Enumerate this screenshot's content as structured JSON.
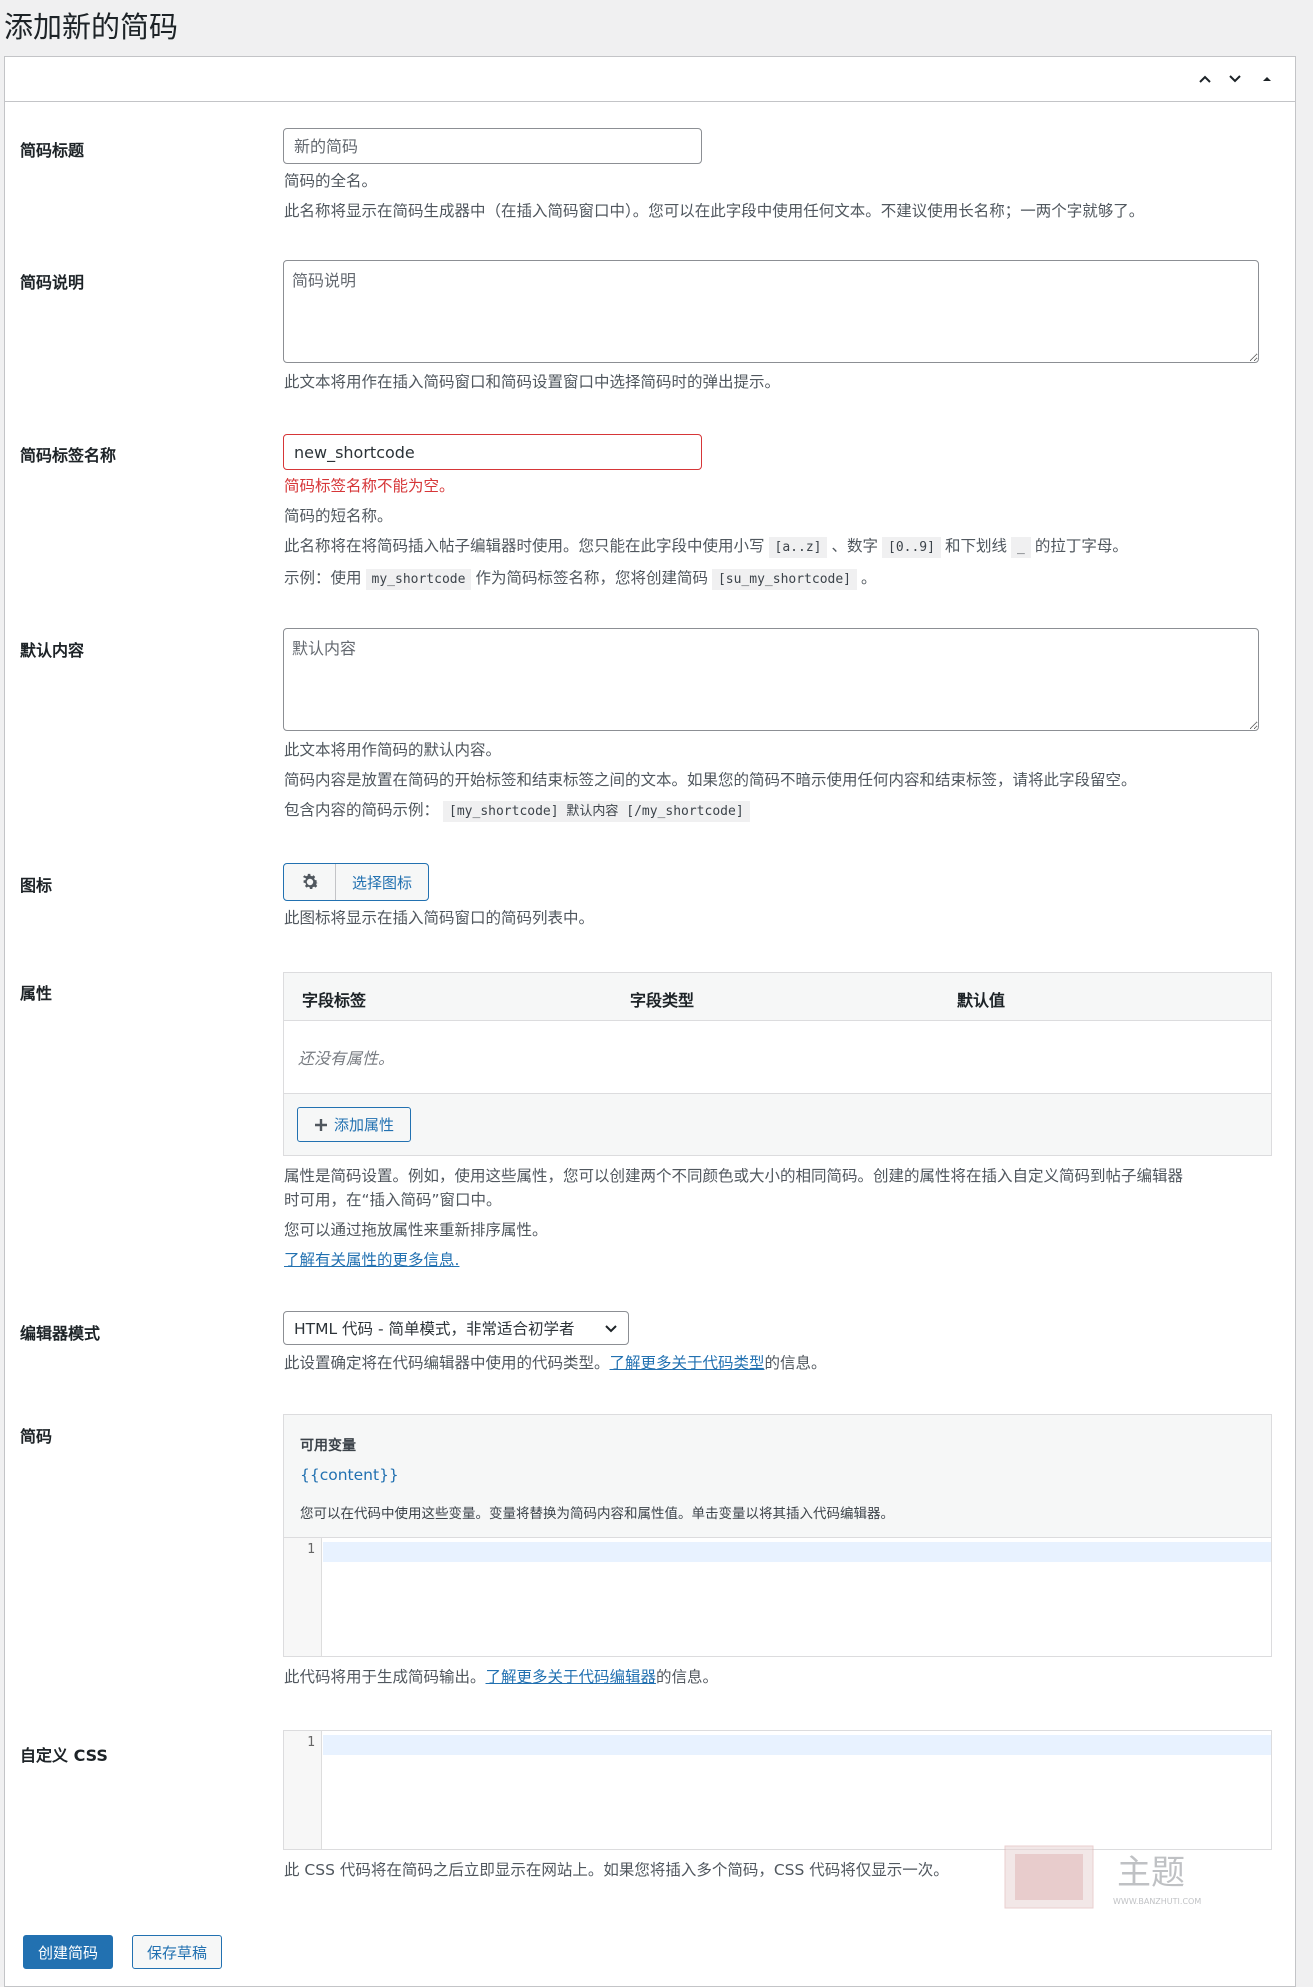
{
  "page": {
    "title": "添加新的简码"
  },
  "fields": {
    "title": {
      "label": "简码标题",
      "placeholder": "新的简码",
      "desc1": "简码的全名。",
      "desc2": "此名称将显示在简码生成器中（在插入简码窗口中）。您可以在此字段中使用任何文本。不建议使用长名称；一两个字就够了。"
    },
    "description": {
      "label": "简码说明",
      "placeholder": "简码说明",
      "desc": "此文本将用作在插入简码窗口和简码设置窗口中选择简码时的弹出提示。"
    },
    "tag": {
      "label": "简码标签名称",
      "value": "new_shortcode",
      "error": "简码标签名称不能为空。",
      "desc1": "简码的短名称。",
      "desc2_a": "此名称将在将简码插入帖子编辑器时使用。您只能在此字段中使用小写",
      "code_az": "[a..z]",
      "desc2_b": "、数字",
      "code_09": "[0..9]",
      "desc2_c": "和下划线",
      "code_us": "_",
      "desc2_d": "的拉丁字母。",
      "desc3_a": "示例：使用",
      "code_tag": "my_shortcode",
      "desc3_b": "作为简码标签名称，您将创建简码",
      "code_full": "[su_my_shortcode]",
      "desc3_c": "。"
    },
    "default_content": {
      "label": "默认内容",
      "placeholder": "默认内容",
      "desc1": "此文本将用作简码的默认内容。",
      "desc2": "简码内容是放置在简码的开始标签和结束标签之间的文本。如果您的简码不暗示使用任何内容和结束标签，请将此字段留空。",
      "desc3_a": "包含内容的简码示例：",
      "code_example": "[my_shortcode] 默认内容 [/my_shortcode]"
    },
    "icon": {
      "label": "图标",
      "icon_name": "gear-icon",
      "button": "选择图标",
      "desc": "此图标将显示在插入简码窗口的简码列表中。"
    },
    "attributes": {
      "label": "属性",
      "columns": [
        "字段标签",
        "字段类型",
        "默认值"
      ],
      "empty": "还没有属性。",
      "add_button": "添加属性",
      "desc1": "属性是简码设置。例如，使用这些属性，您可以创建两个不同颜色或大小的相同简码。创建的属性将在插入自定义简码到帖子编辑器",
      "desc1b": "时可用，在“插入简码”窗口中。",
      "desc2": "您可以通过拖放属性来重新排序属性。",
      "link": "了解有关属性的更多信息."
    },
    "editor_mode": {
      "label": "编辑器模式",
      "selected": "HTML 代码 - 简单模式，非常适合初学者",
      "desc_a": "此设置确定将在代码编辑器中使用的代码类型。",
      "link": "了解更多关于代码类型",
      "desc_b": "的信息。"
    },
    "code": {
      "label": "简码",
      "vars_title": "可用变量",
      "var": "{{content}}",
      "vars_note": "您可以在代码中使用这些变量。变量将替换为简码内容和属性值。单击变量以将其插入代码编辑器。",
      "line": "1",
      "desc_a": "此代码将用于生成简码输出。",
      "link": "了解更多关于代码编辑器",
      "desc_b": "的信息。"
    },
    "css": {
      "label": "自定义 CSS",
      "line": "1",
      "desc": "此 CSS 代码将在简码之后立即显示在网站上。如果您将插入多个简码，CSS 代码将仅显示一次。"
    }
  },
  "actions": {
    "create": "创建简码",
    "draft": "保存草稿"
  },
  "watermark": {
    "text": "主题",
    "sub": "WWW.BANZHUTI.COM"
  },
  "colors": {
    "accent": "#2271b1",
    "error": "#d63638",
    "background": "#f0f0f1"
  }
}
